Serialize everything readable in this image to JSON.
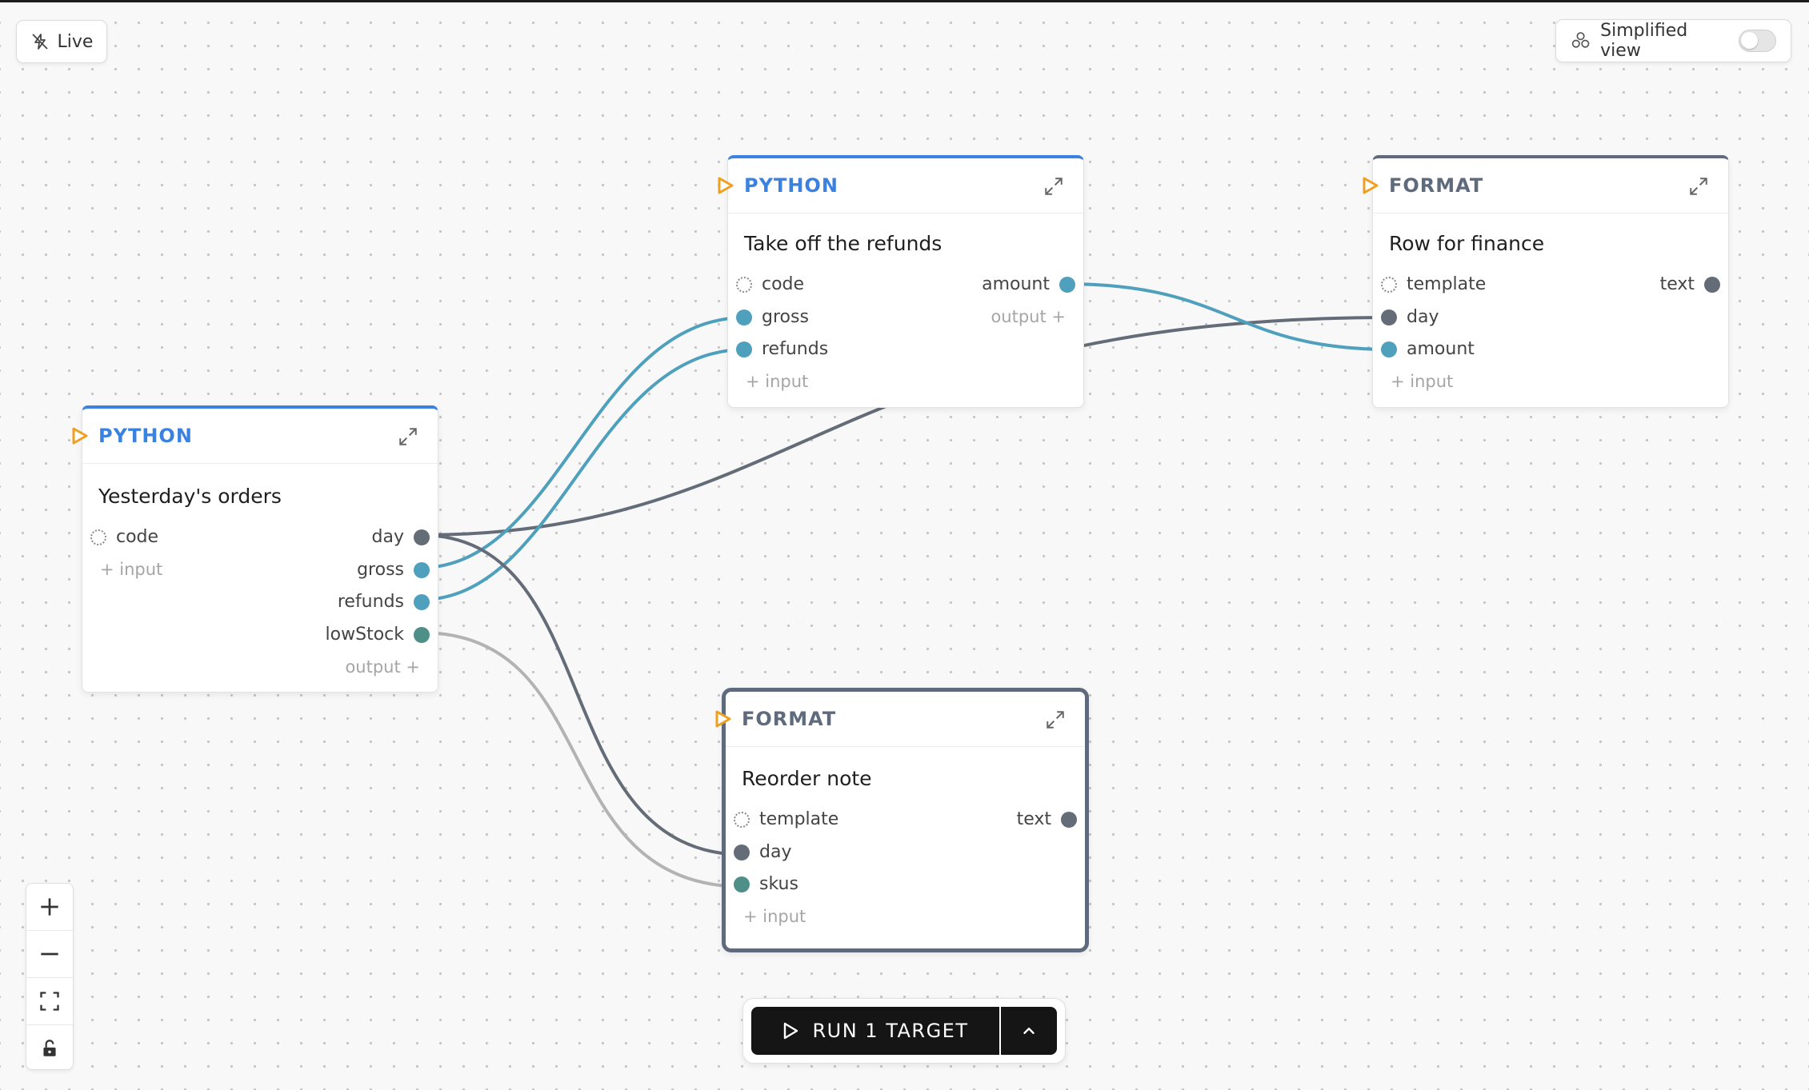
{
  "toolbar": {
    "live_label": "Live",
    "simplified_label": "Simplified view",
    "simplified_on": false
  },
  "nodes": {
    "orders": {
      "type": "PYTHON",
      "title": "Yesterday's orders",
      "inputs": [
        "code"
      ],
      "add_input": "+ input",
      "outputs": [
        "day",
        "gross",
        "refunds",
        "lowStock"
      ],
      "add_output": "output +"
    },
    "refunds": {
      "type": "PYTHON",
      "title": "Take off the refunds",
      "inputs": [
        "code",
        "gross",
        "refunds"
      ],
      "add_input": "+ input",
      "outputs": [
        "amount"
      ],
      "add_output": "output +"
    },
    "finance": {
      "type": "FORMAT",
      "title": "Row for finance",
      "inputs": [
        "template",
        "day",
        "amount"
      ],
      "add_input": "+ input",
      "outputs": [
        "text"
      ]
    },
    "reorder": {
      "type": "FORMAT",
      "title": "Reorder note",
      "inputs": [
        "template",
        "day",
        "skus"
      ],
      "add_input": "+ input",
      "outputs": [
        "text"
      ]
    }
  },
  "run": {
    "label": "RUN 1 TARGET"
  },
  "colors": {
    "python_accent": "#3b82e0",
    "format_accent": "#5f6b7d",
    "port_blue": "#4fa0bd",
    "port_grey": "#646c78",
    "port_teal": "#4e8f88",
    "run_button": "#151515",
    "trigger_orange": "#f0a020"
  },
  "icons": {
    "live": "live-off-icon",
    "simplified": "nodes-icon",
    "expand": "expand-icon",
    "trigger": "play-trigger-icon",
    "zoom_in": "plus-icon",
    "zoom_out": "minus-icon",
    "fit": "fit-view-icon",
    "lock": "lock-icon",
    "run": "play-icon",
    "more": "chevron-up-icon"
  }
}
